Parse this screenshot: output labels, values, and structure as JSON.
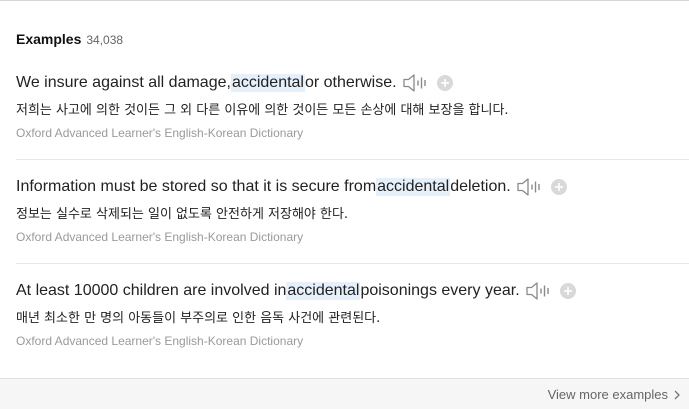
{
  "header": {
    "title": "Examples",
    "count": "34,038"
  },
  "examples": [
    {
      "en_before": "We insure against all damage, ",
      "keyword": "accidental",
      "en_after": " or otherwise.",
      "ko": "저희는 사고에 의한 것이든 그 외 다른 이유에 의한 것이든 모든 손상에 대해 보장을 합니다.",
      "source": "Oxford Advanced Learner's English-Korean Dictionary"
    },
    {
      "en_before": "Information must be stored so that it is secure from ",
      "keyword": "accidental",
      "en_after": " deletion.",
      "ko": "정보는 실수로 삭제되는 일이 없도록 안전하게 저장해야 한다.",
      "source": "Oxford Advanced Learner's English-Korean Dictionary"
    },
    {
      "en_before": "At least 10000 children are involved in ",
      "keyword": "accidental",
      "en_after": " poisonings every year.",
      "ko": "매년 최소한 만 명의 아동들이 부주의로 인한 음독 사건에 관련된다.",
      "source": "Oxford Advanced Learner's English-Korean Dictionary"
    }
  ],
  "footer": {
    "more_label": "View more examples"
  },
  "icons": {
    "speaker": "speaker-icon",
    "add": "plus-circle-icon",
    "more": "chevron-right-icon"
  },
  "colors": {
    "highlight": "#e6f0fb",
    "source_text": "#9a9a9a",
    "icon": "#8a8a8a"
  }
}
